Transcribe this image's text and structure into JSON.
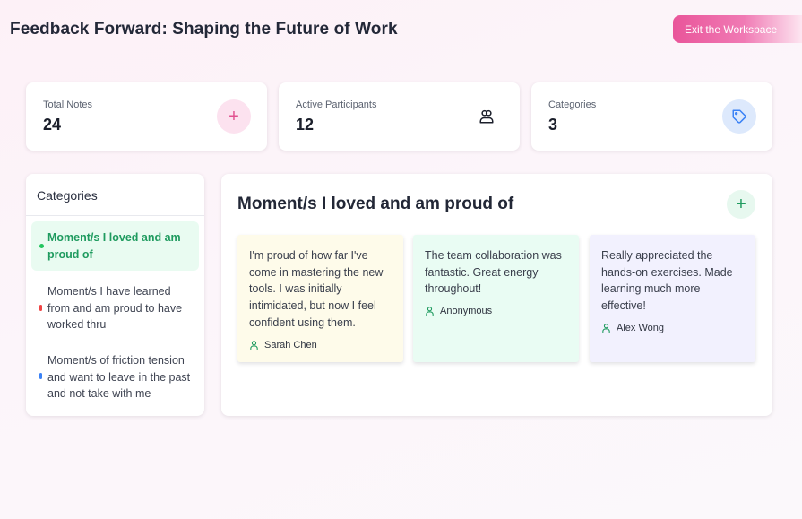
{
  "header": {
    "title": "Feedback Forward: Shaping the Future of Work",
    "exit_label": "Exit the Workspace"
  },
  "stats": [
    {
      "label": "Total Notes",
      "value": "24",
      "icon": "plus-icon"
    },
    {
      "label": "Active Participants",
      "value": "12",
      "icon": "users-icon"
    },
    {
      "label": "Categories",
      "value": "3",
      "icon": "tag-icon"
    }
  ],
  "categories": {
    "title": "Categories",
    "items": [
      {
        "label": "Moment/s I loved and am proud of",
        "marker_color": "#22c55e",
        "active": true
      },
      {
        "label": "Moment/s I have learned from and am proud to have worked thru",
        "marker_color": "#ef4444",
        "active": false
      },
      {
        "label": "Moment/s of friction tension and want to leave in the past and not take with me",
        "marker_color": "#3b82f6",
        "active": false
      }
    ]
  },
  "main": {
    "title": "Moment/s I loved and am proud of",
    "notes": [
      {
        "text": "I'm proud of how far I've come in mastering the new tools. I was initially intimidated, but now I feel confident using them.",
        "author": "Sarah Chen",
        "color": "#fefbea"
      },
      {
        "text": "The team collaboration was fantastic. Great energy throughout!",
        "author": "Anonymous",
        "color": "#e9fcf3"
      },
      {
        "text": "Really appreciated the hands-on exercises. Made learning much more effective!",
        "author": "Alex Wong",
        "color": "#f2f1fe"
      }
    ]
  },
  "colors": {
    "accent_pink": "#e9559a",
    "accent_green": "#1f9b5f",
    "accent_blue": "#3b82f6"
  }
}
